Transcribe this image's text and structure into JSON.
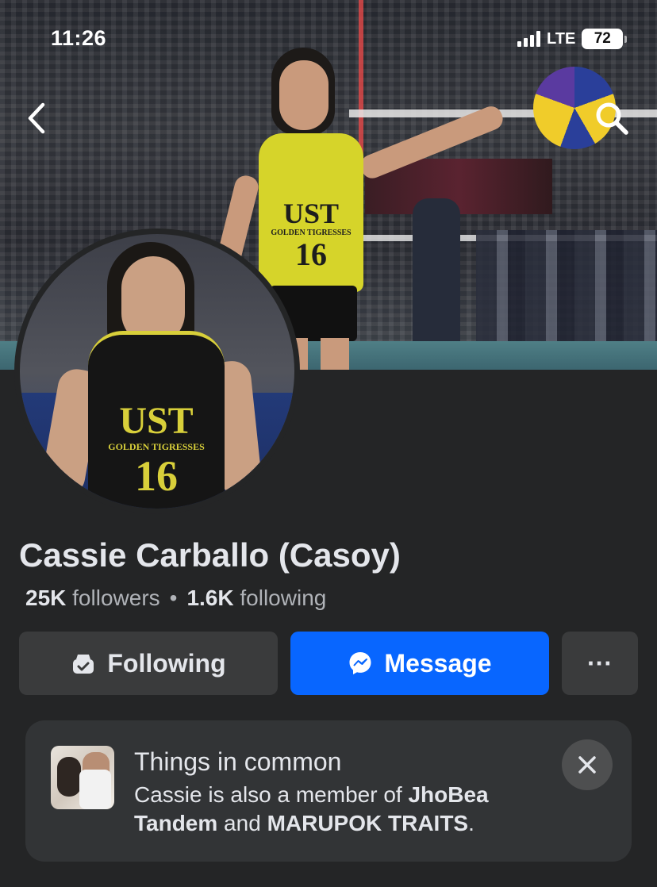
{
  "status_bar": {
    "time": "11:26",
    "network": "LTE",
    "battery": "72"
  },
  "header": {
    "back_icon": "chevron-left-icon",
    "search_icon": "search-icon"
  },
  "cover": {
    "jersey_school": "UST",
    "jersey_team": "GOLDEN TIGRESSES",
    "jersey_number": "16"
  },
  "avatar": {
    "jersey_school": "UST",
    "jersey_team": "GOLDEN TIGRESSES",
    "jersey_number": "16"
  },
  "profile": {
    "name": "Cassie Carballo (Casoy)",
    "followers_count": "25K",
    "followers_label": "followers",
    "separator": "•",
    "following_count": "1.6K",
    "following_label": "following"
  },
  "actions": {
    "following_label": "Following",
    "message_label": "Message",
    "more_label": "···"
  },
  "things_in_common": {
    "title": "Things in common",
    "text_prefix": "Cassie is also a member of ",
    "group_1": "JhoBea Tandem",
    "conjunction": " and ",
    "group_2": "MARUPOK TRAITS",
    "suffix": "."
  },
  "colors": {
    "background": "#242526",
    "primary_blue": "#0866ff",
    "button_gray": "#3a3b3c",
    "card_gray": "#323436",
    "text_primary": "#e4e6eb",
    "text_secondary": "#b0b3b8"
  }
}
